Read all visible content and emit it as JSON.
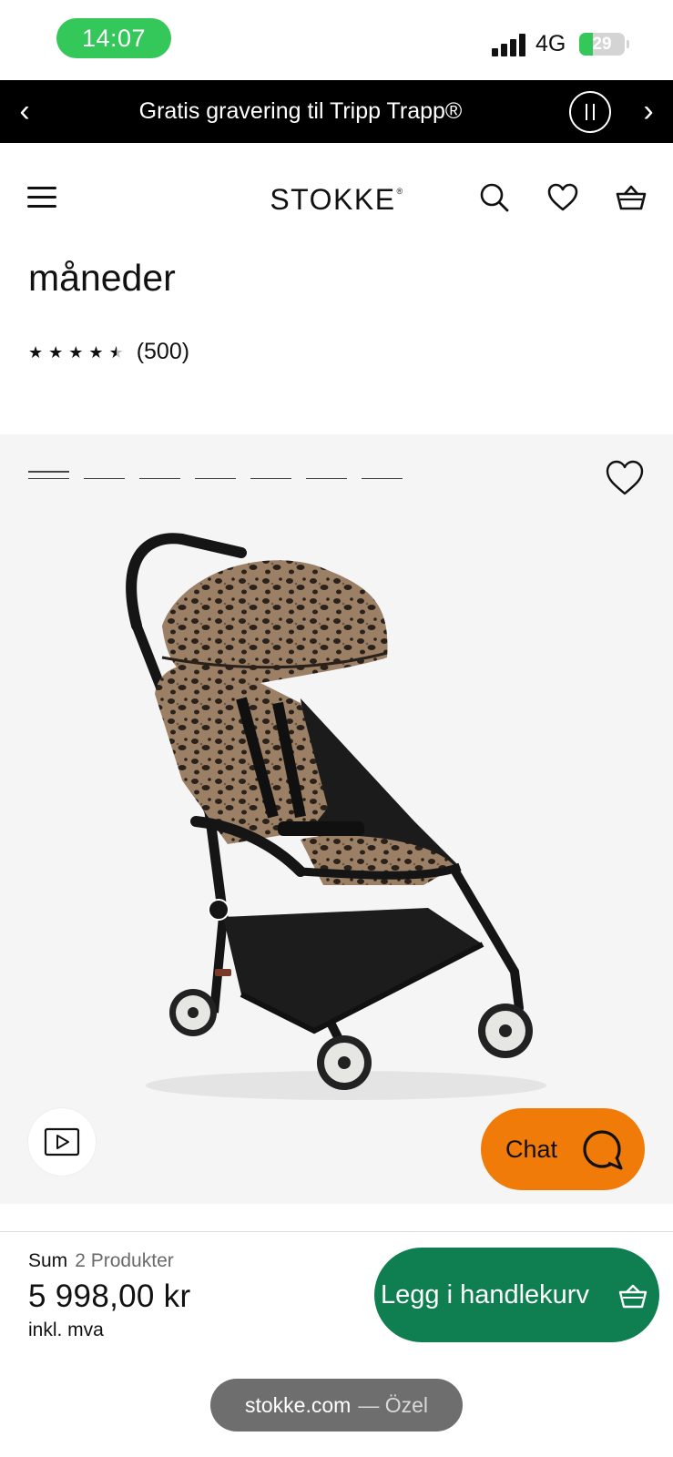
{
  "status_bar": {
    "time": "14:07",
    "network": "4G",
    "battery_level": "29",
    "battery_fraction": 0.29
  },
  "promo": {
    "text": "Gratis gravering til Tripp Trapp®",
    "prev_icon": "chevron-left-icon",
    "next_icon": "chevron-right-icon",
    "pause_icon": "pause-icon"
  },
  "header": {
    "logo": "STOKKE",
    "logo_mark": "®",
    "icons": [
      "menu-icon",
      "search-icon",
      "heart-icon",
      "basket-icon"
    ]
  },
  "product": {
    "title": "måneder",
    "rating_value": 4.5,
    "rating_max": 5,
    "rating_count": "(500)"
  },
  "gallery": {
    "total_images": 7,
    "active_index": 0,
    "image_description": "stroller-leopard-canopy"
  },
  "chat": {
    "label": "Chat"
  },
  "cart": {
    "sum_label": "Sum",
    "products_label": "2 Produkter",
    "price": "5 998,00 kr",
    "vat_note": "inkl. mva",
    "button_label": "Legg i handlekurv"
  },
  "browser": {
    "host": "stokke.com",
    "suffix": "— Özel"
  },
  "colors": {
    "status_green": "#34c759",
    "promo_black": "#000000",
    "chat_orange": "#f07b08",
    "cart_green": "#0f7e50"
  }
}
